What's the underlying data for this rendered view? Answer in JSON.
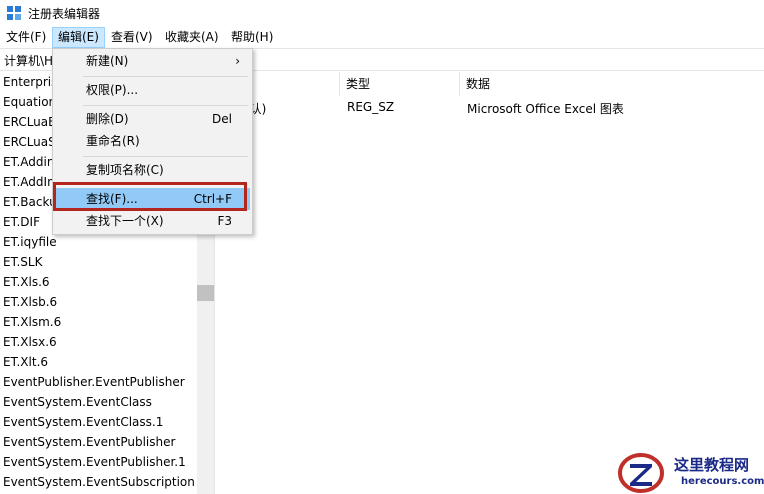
{
  "window": {
    "title": "注册表编辑器"
  },
  "menubar": [
    {
      "label": "文件(F)"
    },
    {
      "label": "编辑(E)"
    },
    {
      "label": "查看(V)"
    },
    {
      "label": "收藏夹(A)"
    },
    {
      "label": "帮助(H)"
    }
  ],
  "address": {
    "path": "计算机\\H"
  },
  "tree": {
    "items": [
      "Enterpris",
      "Equation",
      "ERCLuaE",
      "ERCLuaS",
      "ET.Addin",
      "ET.AddIn",
      "ET.Backu",
      "ET.DIF",
      "ET.iqyfile",
      "ET.SLK",
      "ET.Xls.6",
      "ET.Xlsb.6",
      "ET.Xlsm.6",
      "ET.Xlsx.6",
      "ET.Xlt.6",
      "EventPublisher.EventPublisher",
      "EventSystem.EventClass",
      "EventSystem.EventClass.1",
      "EventSystem.EventPublisher",
      "EventSystem.EventPublisher.1",
      "EventSystem.EventSubscription"
    ]
  },
  "list": {
    "headers": {
      "type": "类型",
      "data": "数据"
    },
    "row": {
      "name": "(默认)",
      "type": "REG_SZ",
      "data": "Microsoft Office Excel 图表"
    }
  },
  "edit_menu": {
    "new": {
      "label": "新建(N)",
      "arrow": "›"
    },
    "permissions": {
      "label": "权限(P)..."
    },
    "delete": {
      "label": "删除(D)",
      "shortcut": "Del"
    },
    "rename": {
      "label": "重命名(R)"
    },
    "copy_key_name": {
      "label": "复制项名称(C)"
    },
    "find": {
      "label": "查找(F)...",
      "shortcut": "Ctrl+F"
    },
    "find_next": {
      "label": "查找下一个(X)",
      "shortcut": "F3"
    }
  },
  "watermark": {
    "title": "这里教程网",
    "url": "herecours.com"
  },
  "colors": {
    "menu_active": "#cce8ff",
    "menu_highlight": "#91c9f7",
    "annotation_red": "#b3261e",
    "watermark_blue": "#1a2a86"
  }
}
